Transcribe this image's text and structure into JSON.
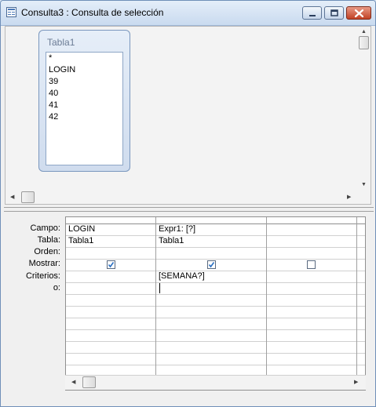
{
  "window": {
    "title": "Consulta3 : Consulta de selección",
    "minimize_glyph": "minimize-icon",
    "maximize_glyph": "maximize-icon",
    "close_glyph": "close-icon"
  },
  "table_box": {
    "name": "Tabla1",
    "fields": [
      "*",
      "LOGIN",
      "39",
      "40",
      "41",
      "42"
    ]
  },
  "grid": {
    "row_labels": [
      "Campo:",
      "Tabla:",
      "Orden:",
      "Mostrar:",
      "Criterios:",
      "o:"
    ],
    "columns": [
      {
        "campo": "LOGIN",
        "tabla": "Tabla1",
        "orden": "",
        "mostrar": true,
        "criterios": "",
        "o": ""
      },
      {
        "campo": "Expr1: [?]",
        "tabla": "Tabla1",
        "orden": "",
        "mostrar": true,
        "criterios": "[SEMANA?]",
        "o": ""
      },
      {
        "campo": "",
        "tabla": "",
        "orden": "",
        "mostrar": false,
        "criterios": "",
        "o": ""
      }
    ]
  },
  "colors": {
    "titlebar": "#c9daef",
    "close_button": "#c24125",
    "checkmark": "#2a6fc2"
  }
}
